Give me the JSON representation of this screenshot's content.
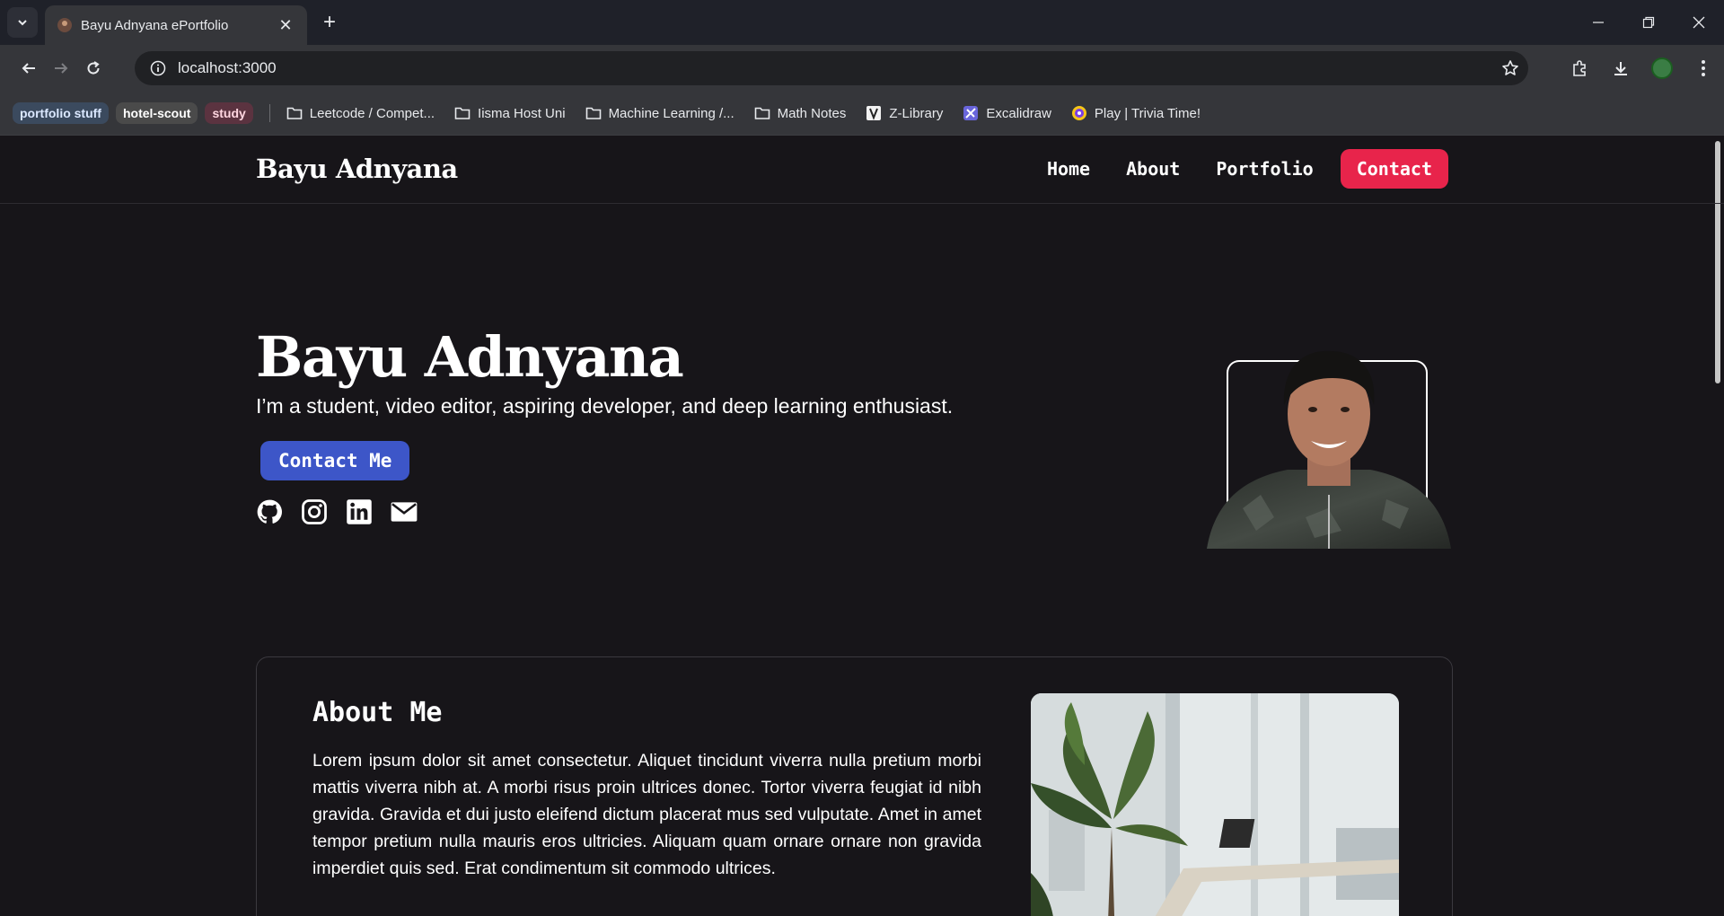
{
  "browser": {
    "tab_title": "Bayu Adnyana ePortfolio",
    "url": "localhost:3000",
    "bookmark_groups": [
      {
        "label": "portfolio stuff",
        "bg": "#3b4a5e",
        "fg": "#dbe8ff"
      },
      {
        "label": "hotel-scout",
        "bg": "#4a4a4a",
        "fg": "#ffffff"
      },
      {
        "label": "study",
        "bg": "#5b3340",
        "fg": "#ffd6e0"
      }
    ],
    "bookmarks": [
      {
        "label": "Leetcode / Compet...",
        "icon": "folder-icon"
      },
      {
        "label": "Iisma Host Uni",
        "icon": "folder-icon"
      },
      {
        "label": "Machine Learning /...",
        "icon": "folder-icon"
      },
      {
        "label": "Math Notes",
        "icon": "folder-icon"
      },
      {
        "label": "Z-Library",
        "icon": "zlibrary-icon"
      },
      {
        "label": "Excalidraw",
        "icon": "excalidraw-icon"
      },
      {
        "label": "Play | Trivia Time!",
        "icon": "trivia-icon"
      }
    ]
  },
  "site": {
    "brand": "Bayu Adnyana",
    "nav": {
      "home": "Home",
      "about": "About",
      "portfolio": "Portfolio",
      "contact": "Contact"
    },
    "hero": {
      "name": "Bayu Adnyana",
      "subtitle": "I’m a student, video editor, aspiring developer, and deep learning enthusiast.",
      "cta": "Contact Me",
      "socials": [
        "github-icon",
        "instagram-icon",
        "linkedin-icon",
        "mail-icon"
      ]
    },
    "about": {
      "title": "About Me",
      "body": "Lorem ipsum dolor sit amet consectetur. Aliquet tincidunt viverra nulla pretium morbi mattis viverra nibh at. A morbi risus proin ultrices donec. Tortor viverra feugiat id nibh gravida. Gravida et dui justo eleifend dictum placerat mus sed vulputate. Amet in amet tempor pretium nulla mauris eros ultricies. Aliquam quam ornare ornare non gravida imperdiet quis sed. Erat condimentum sit commodo ultrices."
    },
    "colors": {
      "background": "#171519",
      "accent_contact": "#e8244b",
      "accent_cta": "#3d56c8"
    }
  }
}
